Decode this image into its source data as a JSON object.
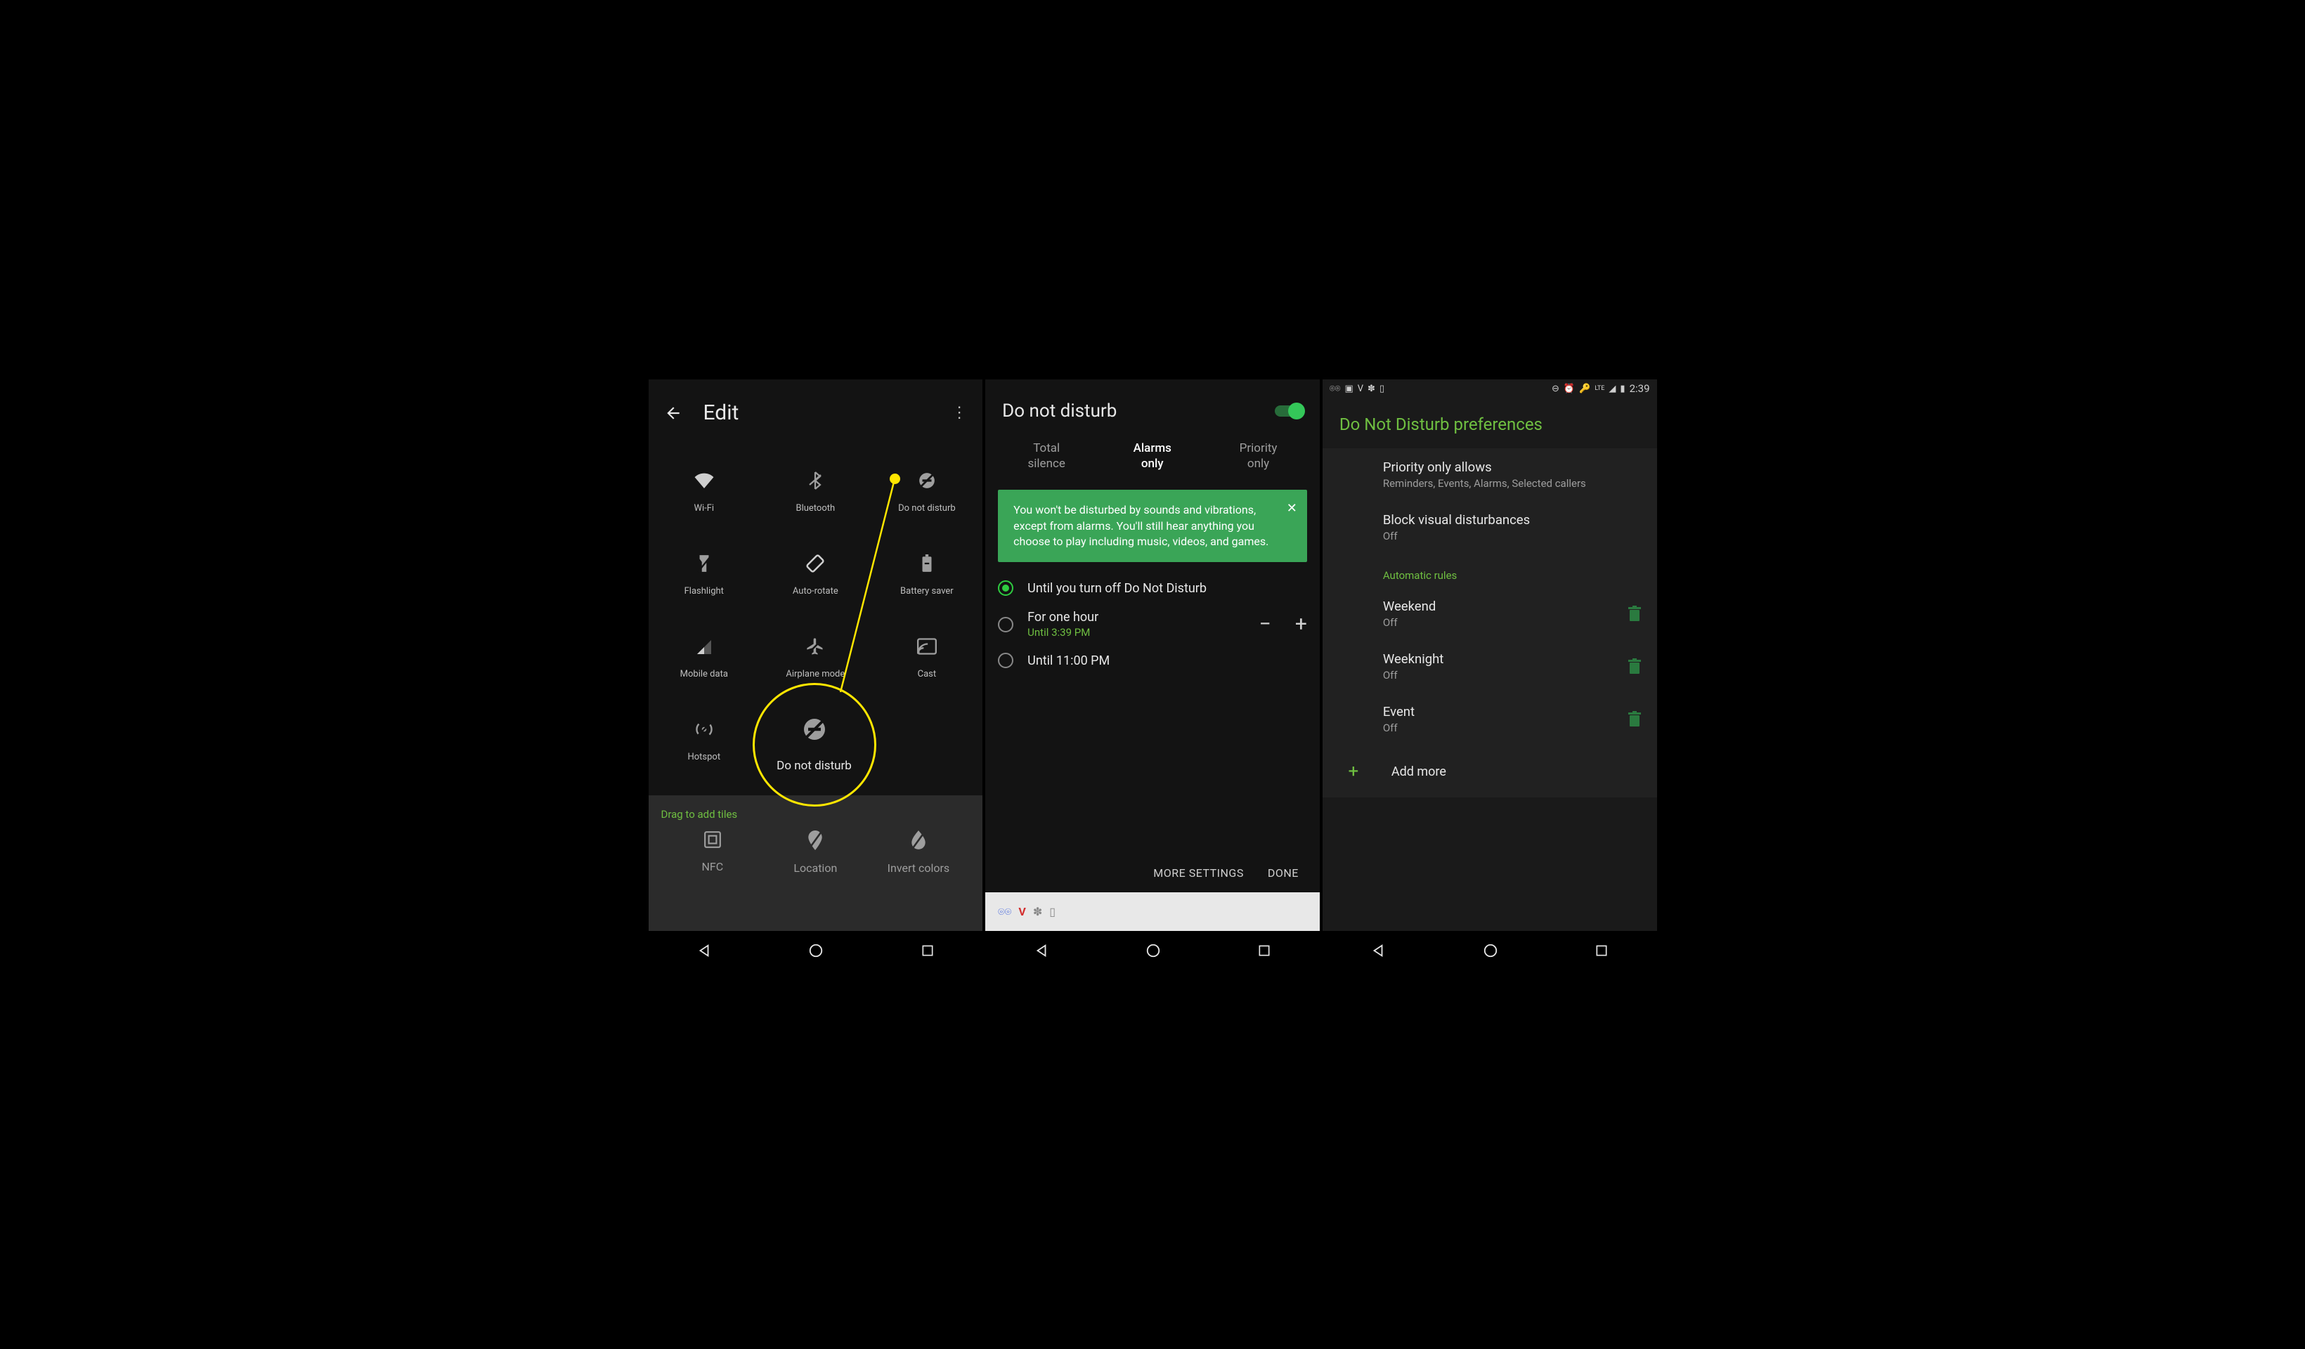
{
  "panel1": {
    "title": "Edit",
    "tiles": [
      {
        "label": "Wi-Fi",
        "icon": "wifi"
      },
      {
        "label": "Bluetooth",
        "icon": "bluetooth"
      },
      {
        "label": "Do not disturb",
        "icon": "dnd"
      },
      {
        "label": "Flashlight",
        "icon": "flashlight"
      },
      {
        "label": "Auto-rotate",
        "icon": "rotate"
      },
      {
        "label": "Battery saver",
        "icon": "battery"
      },
      {
        "label": "Mobile data",
        "icon": "signal"
      },
      {
        "label": "Airplane mode",
        "icon": "airplane"
      },
      {
        "label": "Cast",
        "icon": "cast"
      },
      {
        "label": "Hotspot",
        "icon": "hotspot"
      }
    ],
    "drag_label": "Drag to add tiles",
    "drag_tiles": [
      {
        "label": "NFC",
        "icon": "nfc"
      },
      {
        "label": "Location",
        "icon": "location"
      },
      {
        "label": "Invert colors",
        "icon": "invert"
      }
    ],
    "highlight_label": "Do not disturb"
  },
  "panel2": {
    "title": "Do not disturb",
    "toggle": true,
    "tabs": [
      {
        "line1": "Total",
        "line2": "silence",
        "selected": false
      },
      {
        "line1": "Alarms",
        "line2": "only",
        "selected": true
      },
      {
        "line1": "Priority",
        "line2": "only",
        "selected": false
      }
    ],
    "info": "You won't be disturbed by sounds and vibrations, except from alarms. You'll still hear anything you choose to play including music, videos, and games.",
    "options": [
      {
        "label": "Until you turn off Do Not Disturb",
        "checked": true
      },
      {
        "label": "For one hour",
        "sub": "Until 3:39 PM",
        "checked": false,
        "stepper": true
      },
      {
        "label": "Until 11:00 PM",
        "checked": false
      }
    ],
    "more": "MORE SETTINGS",
    "done": "DONE"
  },
  "panel3": {
    "status_time": "2:39",
    "title": "Do Not Disturb preferences",
    "rows": [
      {
        "title": "Priority only allows",
        "sub": "Reminders, Events, Alarms, Selected callers"
      },
      {
        "title": "Block visual disturbances",
        "sub": "Off"
      }
    ],
    "section": "Automatic rules",
    "rules": [
      {
        "title": "Weekend",
        "sub": "Off"
      },
      {
        "title": "Weeknight",
        "sub": "Off"
      },
      {
        "title": "Event",
        "sub": "Off"
      }
    ],
    "add": "Add more"
  }
}
